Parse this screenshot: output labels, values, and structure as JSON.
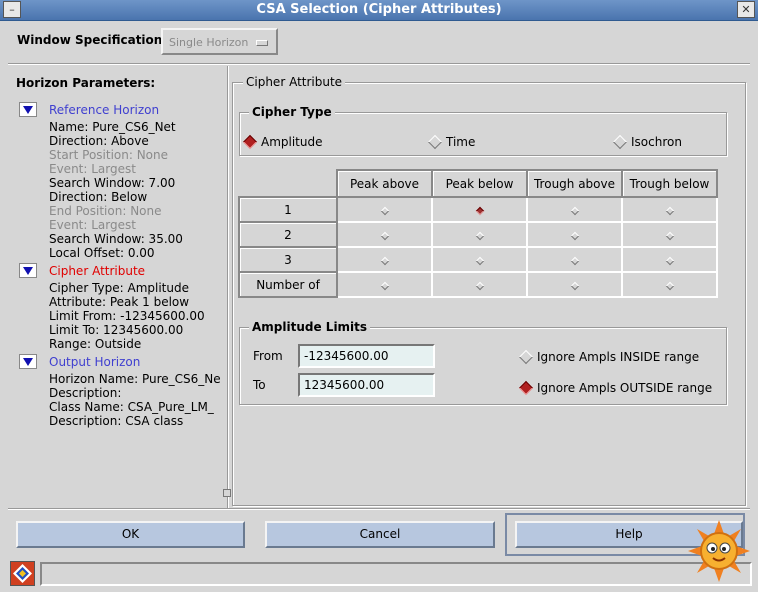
{
  "window": {
    "title": "CSA Selection (Cipher Attributes)",
    "minimize_glyph": "–",
    "close_glyph": "✕"
  },
  "spec": {
    "label": "Window Specification",
    "value": "Single Horizon"
  },
  "left": {
    "title": "Horizon Parameters:",
    "sections": [
      {
        "heading": "Reference Horizon",
        "lines": [
          {
            "text": "Name:  Pure_CS6_Net",
            "disabled": false
          },
          {
            "text": "Direction: Above",
            "disabled": false
          },
          {
            "text": "Start Position: None",
            "disabled": true
          },
          {
            "text": "Event: Largest",
            "disabled": true
          },
          {
            "text": "Search Window: 7.00",
            "disabled": false
          },
          {
            "text": "Direction: Below",
            "disabled": false
          },
          {
            "text": "End Position: None",
            "disabled": true
          },
          {
            "text": "Event: Largest",
            "disabled": true
          },
          {
            "text": "Search Window: 35.00",
            "disabled": false
          },
          {
            "text": "Local Offset:  0.00",
            "disabled": false
          }
        ]
      },
      {
        "heading": "Cipher Attribute",
        "lines": [
          {
            "text": "Cipher Type: Amplitude"
          },
          {
            "text": "Attribute: Peak 1 below"
          },
          {
            "text": "Limit From: -12345600.00"
          },
          {
            "text": "Limit To: 12345600.00"
          },
          {
            "text": "Range: Outside"
          }
        ]
      },
      {
        "heading": "Output Horizon",
        "lines": [
          {
            "text": "Horizon Name:  Pure_CS6_Ne"
          },
          {
            "text": "Description:"
          },
          {
            "text": "Class Name:  CSA_Pure_LM_"
          },
          {
            "text": "Description:  CSA class"
          }
        ]
      }
    ]
  },
  "cipher": {
    "group_title": "Cipher Attribute",
    "type_title": "Cipher Type",
    "types": [
      {
        "label": "Amplitude",
        "selected": true
      },
      {
        "label": "Time",
        "selected": false
      },
      {
        "label": "Isochron",
        "selected": false
      }
    ],
    "columns": [
      "Peak above",
      "Peak below",
      "Trough above",
      "Trough below"
    ],
    "rows": [
      "1",
      "2",
      "3",
      "Number of"
    ],
    "selected_cell": {
      "row": "1",
      "column": "Peak below"
    }
  },
  "limits": {
    "title": "Amplitude Limits",
    "from_label": "From",
    "from_value": "-12345600.00",
    "to_label": "To",
    "to_value": "12345600.00",
    "options": [
      {
        "label": "Ignore Ampls INSIDE range",
        "selected": false
      },
      {
        "label": "Ignore Ampls OUTSIDE range",
        "selected": true
      }
    ]
  },
  "buttons": {
    "ok": "OK",
    "cancel": "Cancel",
    "help": "Help"
  },
  "colors": {
    "titlebar": "#4a74ae",
    "button": "#b7c7df",
    "field": "#e6f1f1",
    "selected_radio": "#b02020",
    "red_heading": "#e00000",
    "blue_heading": "#4040d0"
  }
}
